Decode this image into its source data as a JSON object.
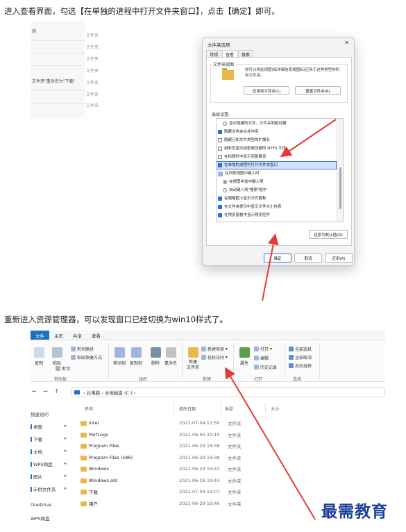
{
  "caption1": "进入查看界面，勾选【在单独的进程中打开文件夹窗口】，点击【确定】即可。",
  "caption2": "重新进入资源管理器，可以发现窗口已经切换为win10样式了。",
  "bg_explorer": {
    "rows": [
      "间",
      "文件夹\"重命名为\"下载\""
    ],
    "kinds": [
      "文件夹",
      "文件夹",
      "文件夹",
      "文件夹",
      "文件夹",
      "文件夹",
      "文件夹"
    ]
  },
  "dialog": {
    "title": "文件夹选项",
    "close": "✕",
    "tabs": [
      "常规",
      "查看",
      "搜索"
    ],
    "folder_views_title": "文件夹视图",
    "folder_views_desc": "你可以将此视图(如详细信息或图标)应用于这种类型的所有文件夹。",
    "apply_to_folders": "应用到文件夹(L)",
    "reset_folders": "重置文件夹(R)",
    "advanced_title": "高级设置:",
    "tree_items": [
      {
        "kind": "radio",
        "checked": false,
        "label": "显示隐藏的文件、文件夹和驱动器"
      },
      {
        "kind": "check",
        "checked": true,
        "label": "隐藏文件夹合并冲突"
      },
      {
        "kind": "check",
        "checked": false,
        "label": "隐藏已知文件类型的扩展名"
      },
      {
        "kind": "check",
        "checked": false,
        "label": "用彩色显示加密或压缩的 NTFS 文件"
      },
      {
        "kind": "check",
        "checked": false,
        "label": "在标题栏中显示完整路径"
      },
      {
        "kind": "check",
        "checked": true,
        "label": "在单独的进程中打开文件夹窗口",
        "highlight": true
      },
      {
        "kind": "group",
        "checked": false,
        "label": "在列表视图中键入时"
      },
      {
        "kind": "radio",
        "checked": true,
        "label": "在视图中选中键入项"
      },
      {
        "kind": "radio",
        "checked": false,
        "label": "自动键入到\"搜索\"框中"
      },
      {
        "kind": "check",
        "checked": true,
        "label": "在缩略图上显示文件图标"
      },
      {
        "kind": "check",
        "checked": true,
        "label": "在文件夹提示中显示文件大小信息"
      },
      {
        "kind": "check",
        "checked": true,
        "label": "在预览窗格中显示预览控件"
      }
    ],
    "restore_defaults": "还原为默认值(D)",
    "ok": "确定",
    "cancel": "取消",
    "apply": "应用(A)"
  },
  "explorer": {
    "ribbon_tabs": [
      "文件",
      "主页",
      "共享",
      "查看"
    ],
    "ribbon_small": [
      "剪切路径",
      "粘贴快捷方式",
      "剪切",
      "新建项目",
      "轻松访问",
      "打开",
      "编辑",
      "历史记录",
      "全部选择",
      "全部取消",
      "反向选择"
    ],
    "ribbon_big": [
      "复制",
      "粘贴",
      "移动到",
      "复制到",
      "删除",
      "重命名",
      "新建\n文件夹",
      "属性"
    ],
    "ribbon_groups": [
      "剪贴板",
      "组织",
      "新建",
      "打开",
      "选择"
    ],
    "nav_back": "←",
    "nav_forward": "→",
    "nav_up": "↑",
    "address": "›  此电脑  ›  本地磁盘 (C:)  ›",
    "columns": [
      "名称",
      "修改日期",
      "类型",
      "大小"
    ],
    "sidebar": [
      {
        "label": "快速访问",
        "pinned": false
      },
      {
        "label": "桌面",
        "pinned": true
      },
      {
        "label": "下载",
        "pinned": true
      },
      {
        "label": "文档",
        "pinned": true
      },
      {
        "label": "WPS网盘",
        "pinned": true
      },
      {
        "label": "图片",
        "pinned": true
      },
      {
        "label": "示例文件夹",
        "pinned": true
      },
      {
        "label": "OneDrive",
        "pinned": false
      },
      {
        "label": "WPS网盘",
        "pinned": false
      }
    ],
    "files": [
      {
        "name": "Intel",
        "date": "2021-07-04 11:50",
        "type": "文件夹"
      },
      {
        "name": "PerfLogs",
        "date": "2021-06-05 20:10",
        "type": "文件夹"
      },
      {
        "name": "Program Files",
        "date": "2021-06-29 19:38",
        "type": "文件夹"
      },
      {
        "name": "Program Files (x86)",
        "date": "2021-06-29 19:38",
        "type": "文件夹"
      },
      {
        "name": "Windows",
        "date": "2021-06-29 19:43",
        "type": "文件夹"
      },
      {
        "name": "Windows.old",
        "date": "2021-06-29 19:43",
        "type": "文件夹"
      },
      {
        "name": "下载",
        "date": "2021-07-04 14:07",
        "type": "文件夹"
      },
      {
        "name": "用户",
        "date": "2021-06-29 19:40",
        "type": "文件夹"
      }
    ]
  },
  "watermark": "最需教育",
  "colors": {
    "accent": "#1f6fbf",
    "arrow": "#e53935",
    "highlight": "#cfe3ff",
    "folder": "#e8b84a",
    "watermark": "#1c3f9a"
  }
}
